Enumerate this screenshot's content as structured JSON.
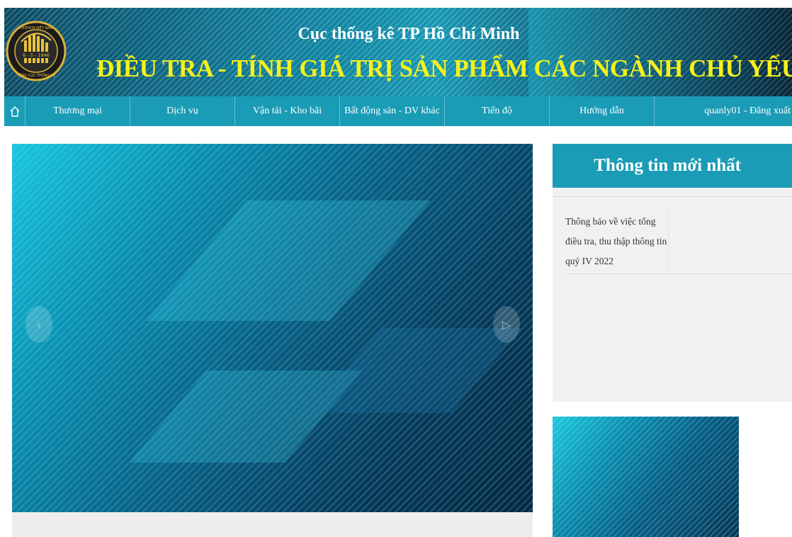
{
  "header": {
    "subtitle": "Cục thống kê TP Hồ Chí Minh",
    "title": "ĐIỀU TRA - TÍNH GIÁ TRỊ SẢN PHẨM CÁC NGÀNH CHỦ YẾU",
    "logo_text_top": "CHXHCN VIỆT NAM",
    "logo_date": "6 - 5 - 1946",
    "logo_text_bottom": "TỔNG CỤC THỐNG KÊ"
  },
  "nav": {
    "home_icon": "home-icon",
    "items": [
      {
        "label": "Thương mại"
      },
      {
        "label": "Dịch vụ"
      },
      {
        "label": "Vận tải - Kho bãi"
      },
      {
        "label": "Bất động sản - DV khác"
      },
      {
        "label": "Tiến độ"
      },
      {
        "label": "Hướng dẫn"
      }
    ],
    "user": "quanly01 - Đăng xuất"
  },
  "slider": {
    "prev_icon": "chevron-left-icon",
    "next_icon": "chevron-right-icon"
  },
  "news": {
    "title": "Thông tin mới nhất",
    "items": [
      {
        "text": "Thông báo về việc tổng điều tra, thu thập thông tin quý IV 2022"
      }
    ]
  },
  "colors": {
    "nav_bg": "#1a9cb6",
    "title_yellow": "#f5f21a",
    "panel_bg": "#f1f1f1"
  }
}
